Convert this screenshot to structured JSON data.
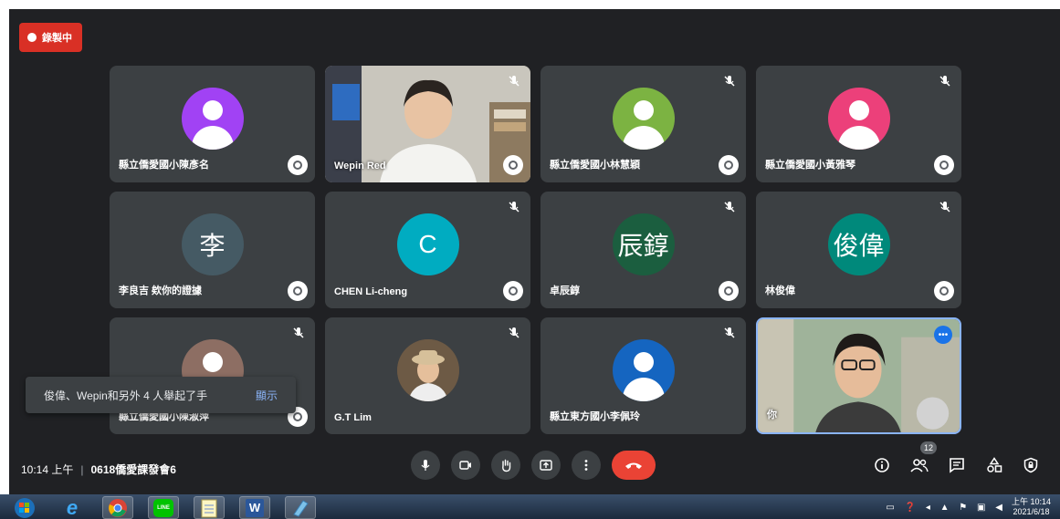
{
  "recording": {
    "label": "錄製中",
    "color": "#d93025"
  },
  "tiles": [
    {
      "name": "縣立僑愛國小陳彥名",
      "avatar_type": "person-icon",
      "avatar_color": "#a142f4",
      "muted": false
    },
    {
      "name": "Wepin Red",
      "avatar_type": "camera",
      "muted": true
    },
    {
      "name": "縣立僑愛國小林慧穎",
      "avatar_type": "person-icon",
      "avatar_color": "#7cb342",
      "muted": true
    },
    {
      "name": "縣立僑愛國小黃雅琴",
      "avatar_type": "person-icon",
      "avatar_color": "#ec407a",
      "muted": true
    },
    {
      "name": "李良吉 欸你的證據",
      "avatar_type": "initials",
      "avatar_text": "李",
      "avatar_color": "#455a64",
      "muted": false
    },
    {
      "name": "CHEN Li-cheng",
      "avatar_type": "initials",
      "avatar_text": "C",
      "avatar_color": "#00acc1",
      "muted": true
    },
    {
      "name": "卓辰錞",
      "avatar_type": "initials",
      "avatar_text": "辰錞",
      "avatar_color": "#1b5e3f",
      "muted": true
    },
    {
      "name": "林俊偉",
      "avatar_type": "initials",
      "avatar_text": "俊偉",
      "avatar_color": "#00897b",
      "muted": true
    },
    {
      "name": "縣立僑愛國小陳淑萍",
      "avatar_type": "person-icon",
      "avatar_color": "#8d6e63",
      "muted": true
    },
    {
      "name": "G.T Lim",
      "avatar_type": "photo",
      "muted": true
    },
    {
      "name": "縣立東方國小李佩玲",
      "avatar_type": "person-icon",
      "avatar_color": "#1565c0",
      "muted": true
    },
    {
      "name": "你",
      "avatar_type": "camera",
      "muted": false
    }
  ],
  "toast": {
    "text": "俊偉、Wepin和另外 4 人舉起了手",
    "action": "顯示"
  },
  "bottom_bar": {
    "time": "10:14 上午",
    "separator": "|",
    "meeting_code": "0618僑愛課發會6",
    "controls": [
      "mic-icon",
      "camera-icon",
      "raise-hand-icon",
      "present-icon",
      "more-options-icon",
      "end-call-icon"
    ],
    "right_controls": [
      "info-icon",
      "people-icon",
      "chat-icon",
      "activities-icon",
      "host-controls-icon"
    ],
    "participant_count": "12",
    "end_call_color": "#ea4335"
  },
  "taskbar": {
    "apps": [
      "windows-start-icon",
      "internet-explorer-icon",
      "chrome-icon",
      "line-icon",
      "notepad-icon",
      "word-icon",
      "app-icon"
    ],
    "clock_time": "上午 10:14",
    "clock_date": "2021/6/18"
  }
}
